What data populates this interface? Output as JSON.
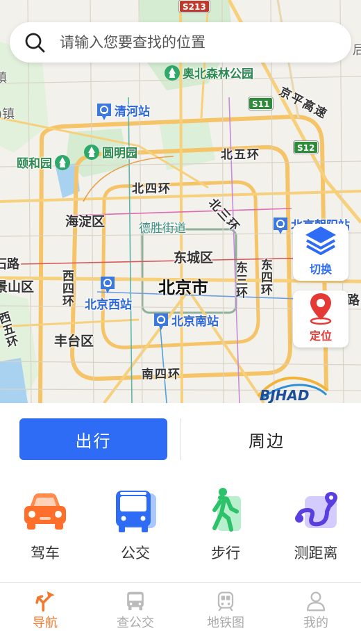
{
  "search": {
    "placeholder": "请输入您要查找的位置"
  },
  "map": {
    "labels": {
      "s213": "S213",
      "s11": "S11",
      "s12": "S12",
      "olympic_park": "奥北森林公园",
      "qinghe_station": "清河站",
      "yuanmingyuan": "圆明园",
      "yiheyuan": "颐和园",
      "jingping_expwy": "京平高速",
      "north_5th_ring": "北五环",
      "north_4th_ring": "北四环",
      "north_3rd_ring": "北三环",
      "haidian": "海淀区",
      "deshengjie": "德胜街道",
      "dongcheng": "东城区",
      "beijing_city": "北京市",
      "shijingshan": "景山区",
      "shijingshan_road": "石路",
      "west_4th_ring": "西四环",
      "west_5th_ring": "西五环",
      "east_3rd_ring": "东三环",
      "east_4th_ring": "东四环",
      "beijing_west_station": "北京西站",
      "beijing_south_station": "北京南站",
      "beijing_chaoyang_station": "北京朝阳站",
      "fengtai": "丰台区",
      "south_4th_ring": "南四环",
      "left_edge_zhen": ")镇",
      "left_edge_dian": "镇",
      "right_edge_lu": "路",
      "right_edge_hou": "后"
    },
    "watermark": "BJHAD"
  },
  "fab": {
    "switch_label": "切换",
    "locate_label": "定位"
  },
  "mode": {
    "travel": "出行",
    "nearby": "周边"
  },
  "actions": [
    {
      "label": "驾车",
      "icon": "car-icon"
    },
    {
      "label": "公交",
      "icon": "bus-icon"
    },
    {
      "label": "步行",
      "icon": "walk-icon"
    },
    {
      "label": "测距离",
      "icon": "measure-distance-icon"
    }
  ],
  "tabs": [
    {
      "label": "导航",
      "icon": "navigation-icon",
      "active": true
    },
    {
      "label": "查公交",
      "icon": "bus-search-icon",
      "active": false
    },
    {
      "label": "地铁图",
      "icon": "subway-map-icon",
      "active": false
    },
    {
      "label": "我的",
      "icon": "profile-icon",
      "active": false
    }
  ],
  "colors": {
    "primary": "#2e6cf6",
    "active_tab": "#f07b2e",
    "inactive_tab": "#aaaaaa"
  }
}
